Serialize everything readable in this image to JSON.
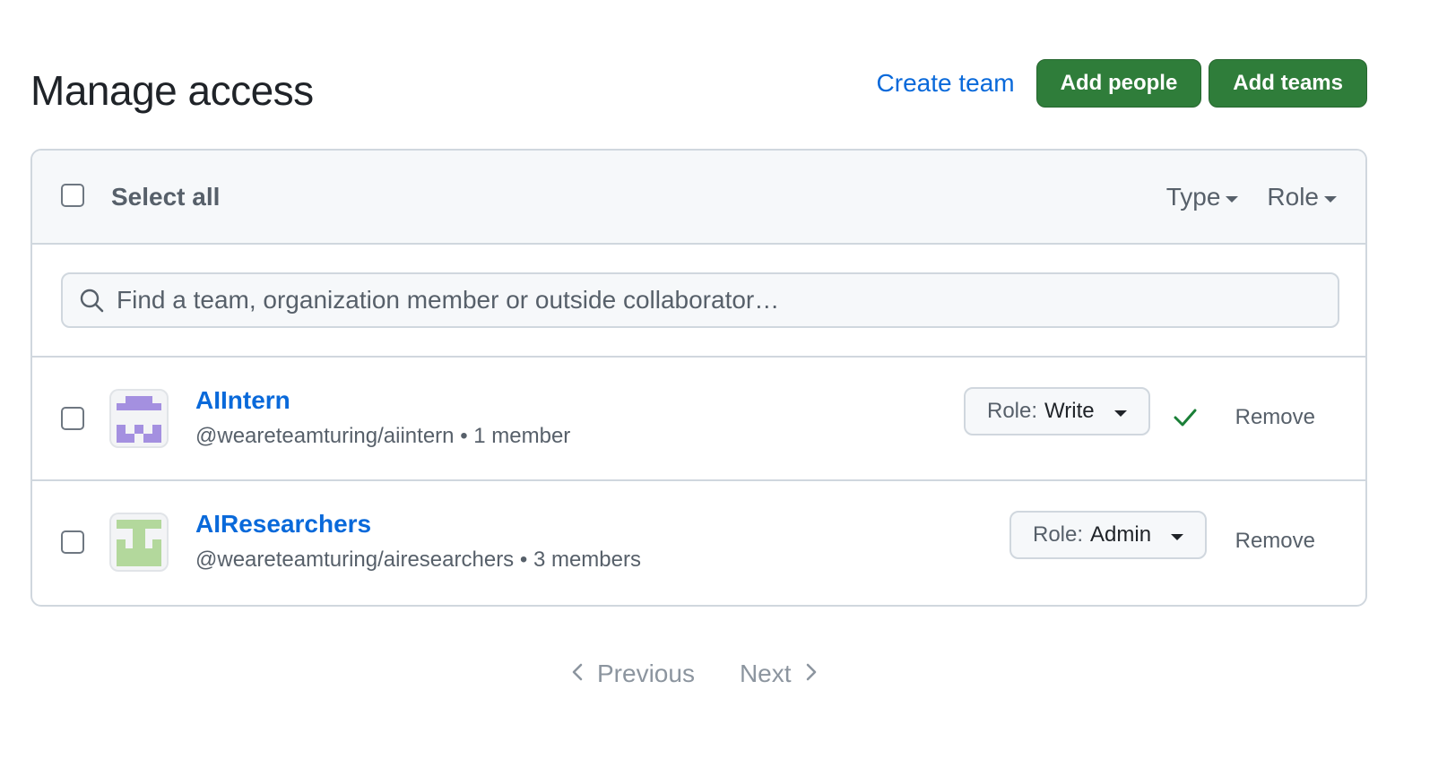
{
  "header": {
    "title": "Manage access",
    "create_team_label": "Create team",
    "add_people_label": "Add people",
    "add_teams_label": "Add teams"
  },
  "list_header": {
    "select_all_label": "Select all",
    "type_filter_label": "Type",
    "role_filter_label": "Role"
  },
  "search": {
    "placeholder": "Find a team, organization member or outside collaborator…"
  },
  "teams": [
    {
      "name": "AIIntern",
      "handle": "@weareteamturing/aiintern",
      "separator": "•",
      "members": "1 member",
      "role_prefix": "Role:",
      "role": "Write",
      "saved": true,
      "remove_label": "Remove",
      "avatar_color": "#a490e0"
    },
    {
      "name": "AIResearchers",
      "handle": "@weareteamturing/airesearchers",
      "separator": "•",
      "members": "3 members",
      "role_prefix": "Role:",
      "role": "Admin",
      "saved": false,
      "remove_label": "Remove",
      "avatar_color": "#b3d89c"
    }
  ],
  "pagination": {
    "previous_label": "Previous",
    "next_label": "Next"
  },
  "colors": {
    "accent_link": "#0969da",
    "primary_button": "#2f7d3a",
    "success_check": "#1a7f37",
    "border": "#d0d7de"
  }
}
